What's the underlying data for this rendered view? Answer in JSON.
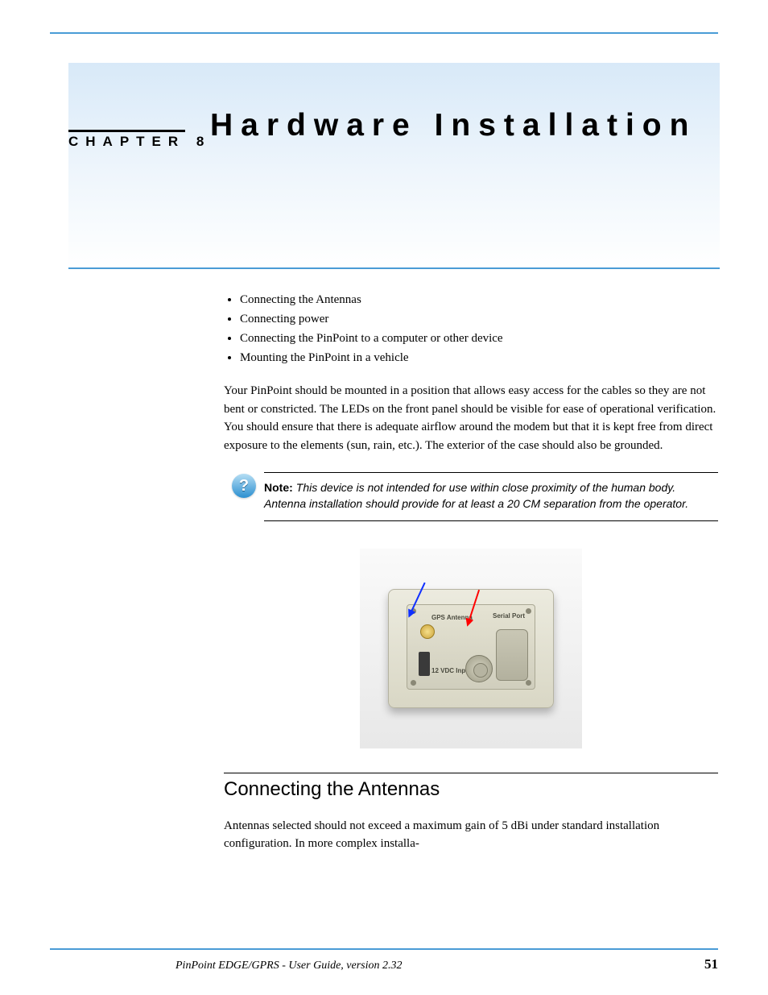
{
  "chapter_label": "CHAPTER 8",
  "title": "Hardware Installation",
  "toc": [
    "Connecting the Antennas",
    "Connecting power",
    "Connecting the PinPoint to a computer or other device",
    "Mounting the PinPoint in a vehicle"
  ],
  "intro": "Your PinPoint should be mounted in a position that allows easy access for the cables so they are not bent or constricted. The LEDs on the front panel should be visible for ease of operational verification. You should ensure that there is adequate airflow around the modem but that it is kept free from direct exposure to the elements (sun, rain, etc.). The exterior of the case should also be grounded.",
  "note_label": "Note:",
  "note_text": "This device is not intended for use within close proximity of the human body. Antenna installation should provide for at least a 20 CM separation from the operator.",
  "device_labels": {
    "gps": "GPS Antenna",
    "serial": "Serial Port",
    "power": "12 VDC Input"
  },
  "h2": "Connecting the Antennas",
  "after_h2": "Antennas selected should not exceed a maximum gain of 5 dBi under standard installation configuration. In more complex installa-",
  "footer_doc": "PinPoint EDGE/GPRS - User Guide, version 2.32",
  "footer_page": "51"
}
